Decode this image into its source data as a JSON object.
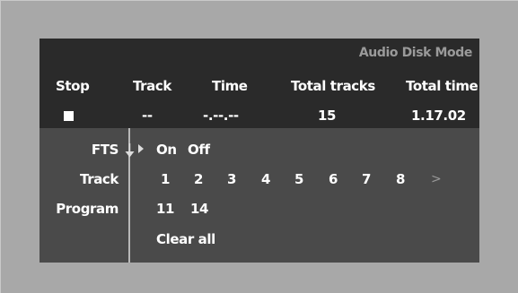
{
  "osd": {
    "mode_title": "Audio Disk Mode",
    "status": {
      "headers": {
        "stop": "Stop",
        "track": "Track",
        "time": "Time",
        "total_tracks": "Total tracks",
        "total_time": "Total time"
      },
      "values": {
        "stop_icon": "stop-square-icon",
        "track": "--",
        "time": "-.--.--",
        "total_tracks": "15",
        "total_time": "1.17.02"
      }
    },
    "menu": {
      "fts": {
        "label": "FTS",
        "on": "On",
        "off": "Off"
      },
      "track": {
        "label": "Track",
        "items": [
          "1",
          "2",
          "3",
          "4",
          "5",
          "6",
          "7",
          "8"
        ],
        "more": ">"
      },
      "program": {
        "label": "Program",
        "items": [
          "11",
          "14"
        ],
        "clear_all": "Clear all"
      }
    }
  },
  "colors": {
    "background": "#a8a8a8",
    "panel_top": "#2a2a2a",
    "panel_bottom": "#4a4a4a",
    "title_text": "#9a9a9a",
    "text": "#ffffff"
  }
}
